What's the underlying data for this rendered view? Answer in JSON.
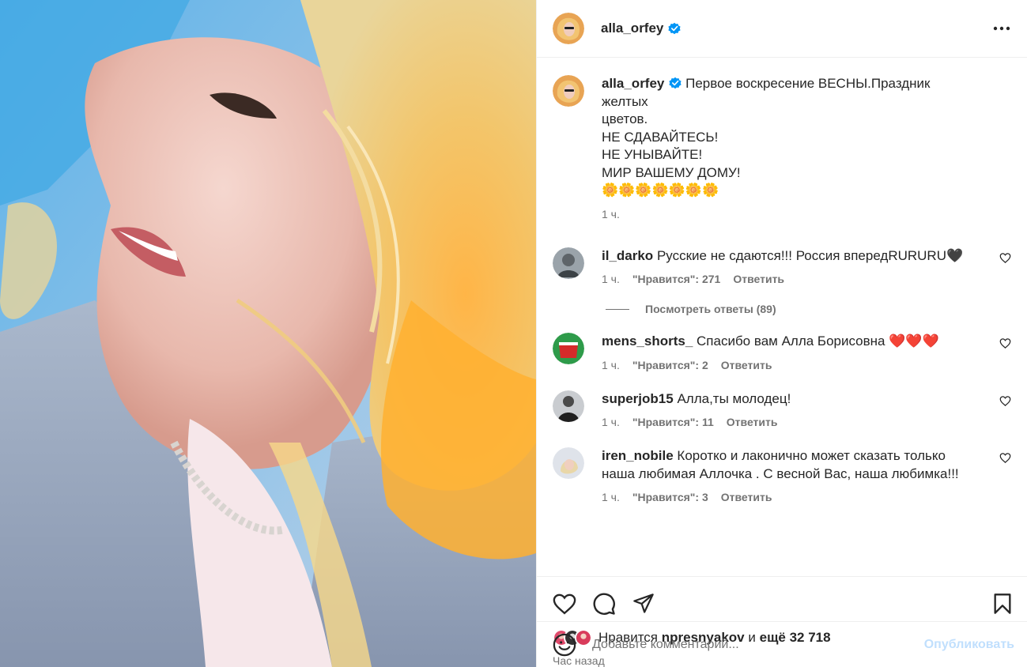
{
  "author": {
    "username": "alla_orfey",
    "verified": true
  },
  "caption": {
    "lines": [
      "Первое воскресение ВЕСНЫ.Праздник желтых",
      "цветов.",
      "НЕ СДАВАЙТЕСЬ!",
      "НЕ УНЫВАЙТЕ!",
      "МИР ВАШЕМУ ДОМУ!",
      "🌼🌼🌼🌼🌼🌼🌼"
    ],
    "time": "1 ч."
  },
  "comments": [
    {
      "username": "il_darko",
      "text": "Русские не сдаются!!! Россия впередRURURU🖤",
      "time": "1 ч.",
      "likes": "\"Нравится\": 271",
      "reply": "Ответить"
    },
    {
      "username": "mens_shorts_",
      "text": "Спасибо вам Алла Борисовна ❤️❤️❤️",
      "time": "1 ч.",
      "likes": "\"Нравится\": 2",
      "reply": "Ответить"
    },
    {
      "username": "superjob15",
      "text": "Алла,ты молодец!",
      "time": "1 ч.",
      "likes": "\"Нравится\": 11",
      "reply": "Ответить"
    },
    {
      "username": "iren_nobile",
      "text": "Коротко и лаконично может сказать только наша любимая Аллочка . С весной Вас, наша любимка!!!",
      "time": "1 ч.",
      "likes": "\"Нравится\": 3",
      "reply": "Ответить"
    }
  ],
  "view_replies": "Посмотреть ответы (89)",
  "likes": {
    "prefix": "Нравится",
    "user": "npresnyakov",
    "middle": "и",
    "rest": "ещё 32 718"
  },
  "posted": "Час назад",
  "comment_box": {
    "placeholder": "Добавьте комментарий...",
    "publish": "Опубликовать"
  },
  "colors": {
    "verified": "#0095f6",
    "publish_disabled": "#c0dffd",
    "secondary_text": "#737373"
  },
  "icons": [
    "more-icon",
    "heart-icon",
    "comment-icon",
    "share-icon",
    "bookmark-icon",
    "emoji-icon",
    "verified-icon"
  ]
}
